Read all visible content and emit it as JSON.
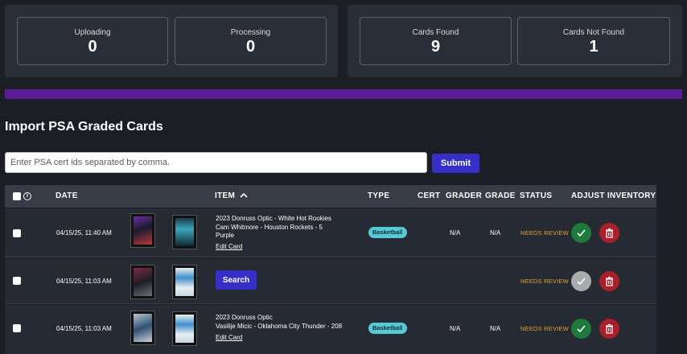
{
  "stats": {
    "uploading": {
      "label": "Uploading",
      "value": "0"
    },
    "processing": {
      "label": "Processing",
      "value": "0"
    },
    "found": {
      "label": "Cards Found",
      "value": "9"
    },
    "not_found": {
      "label": "Cards Not Found",
      "value": "1"
    }
  },
  "progress": {
    "percent": 100,
    "color": "#5a1d96"
  },
  "import": {
    "title": "Import PSA Graded Cards",
    "placeholder": "Enter PSA cert ids separated by comma.",
    "submit_label": "Submit"
  },
  "table": {
    "columns": {
      "date": "DATE",
      "item": "ITEM",
      "type": "TYPE",
      "cert": "CERT",
      "grader": "GRADER",
      "grade": "GRADE",
      "status": "STATUS",
      "adjust": "ADJUST INVENTORY"
    },
    "rows": [
      {
        "date": "04/15/25, 11:40 AM",
        "item_line1": "2023 Donruss Optic - White Hot Rookies",
        "item_line2": "Cam Whitmore - Houston Rockets - 5",
        "item_line3": "Purple",
        "edit": "Edit Card",
        "type": "Basketball",
        "grader": "N/A",
        "grade": "N/A",
        "status": "NEEDS REVIEW"
      },
      {
        "date": "04/15/25, 11:03 AM",
        "search_label": "Search",
        "status": "NEEDS REVIEW"
      },
      {
        "date": "04/15/25, 11:03 AM",
        "item_line1": "2023 Donruss Optic",
        "item_line2": "Vasilije Micic - Oklahoma City Thunder - 208",
        "edit": "Edit Card",
        "type": "Basketball",
        "grader": "N/A",
        "grade": "N/A",
        "status": "NEEDS REVIEW"
      }
    ]
  },
  "icons": {
    "approve": "check-icon",
    "delete": "trash-icon",
    "sort": "chevron-up-icon",
    "info": "info-icon"
  },
  "colors": {
    "primary_button": "#3730c8",
    "approve": "#1e7a3a",
    "delete": "#a9202a",
    "status": "#e0a531",
    "badge": "#57c9d6"
  }
}
